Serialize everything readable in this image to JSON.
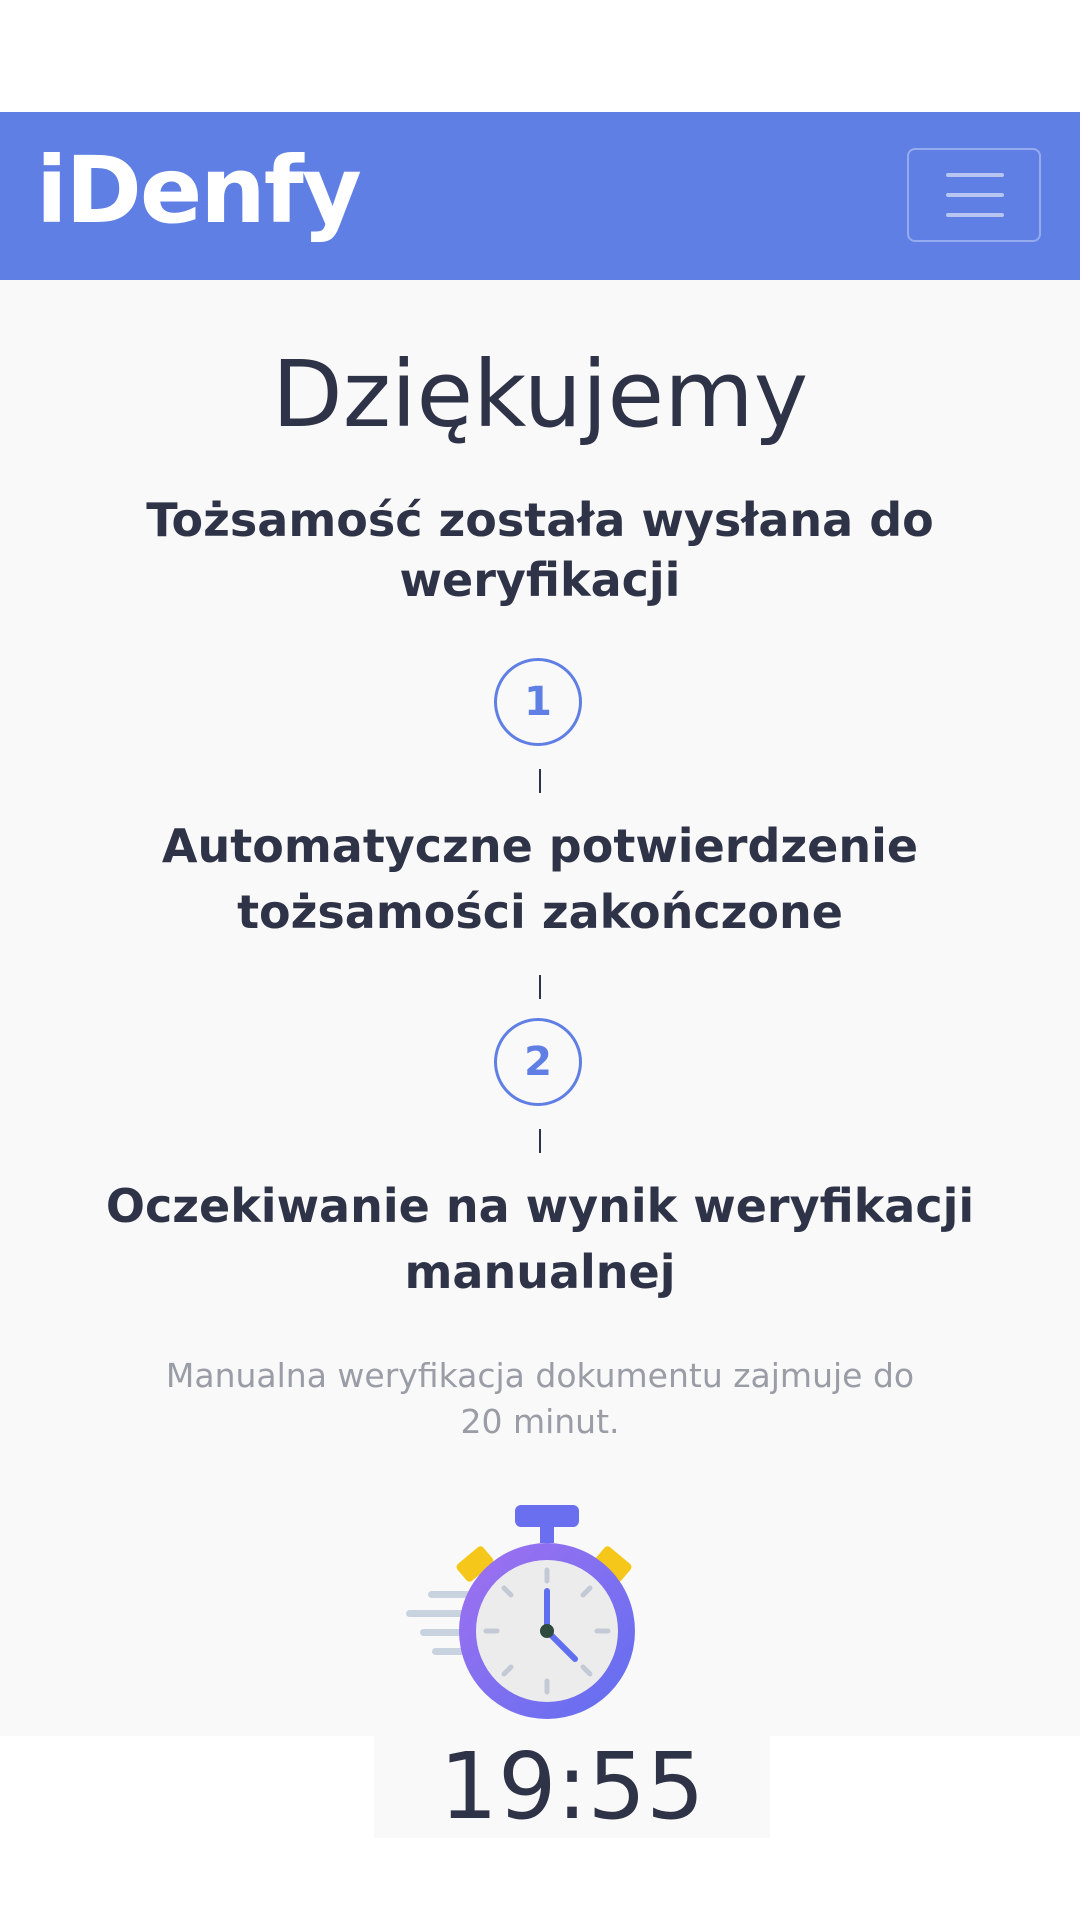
{
  "header": {
    "logo_text": "iDenfy",
    "menu_button": "menu-toggle",
    "brand_color": "#5f7fe4"
  },
  "main": {
    "title": "Dziękujemy",
    "subtitle": "Tożsamość została wysłana do weryfikacji",
    "steps": [
      {
        "number": "1",
        "label": "Automatyczne potwierdzenie tożsamości zakończone"
      },
      {
        "number": "2",
        "label": "Oczekiwanie na wynik weryfikacji manualnej"
      }
    ],
    "note": "Manualna weryfikacja dokumentu zajmuje do 20 minut.",
    "stopwatch_icon": "stopwatch-icon",
    "countdown": "19:55"
  }
}
